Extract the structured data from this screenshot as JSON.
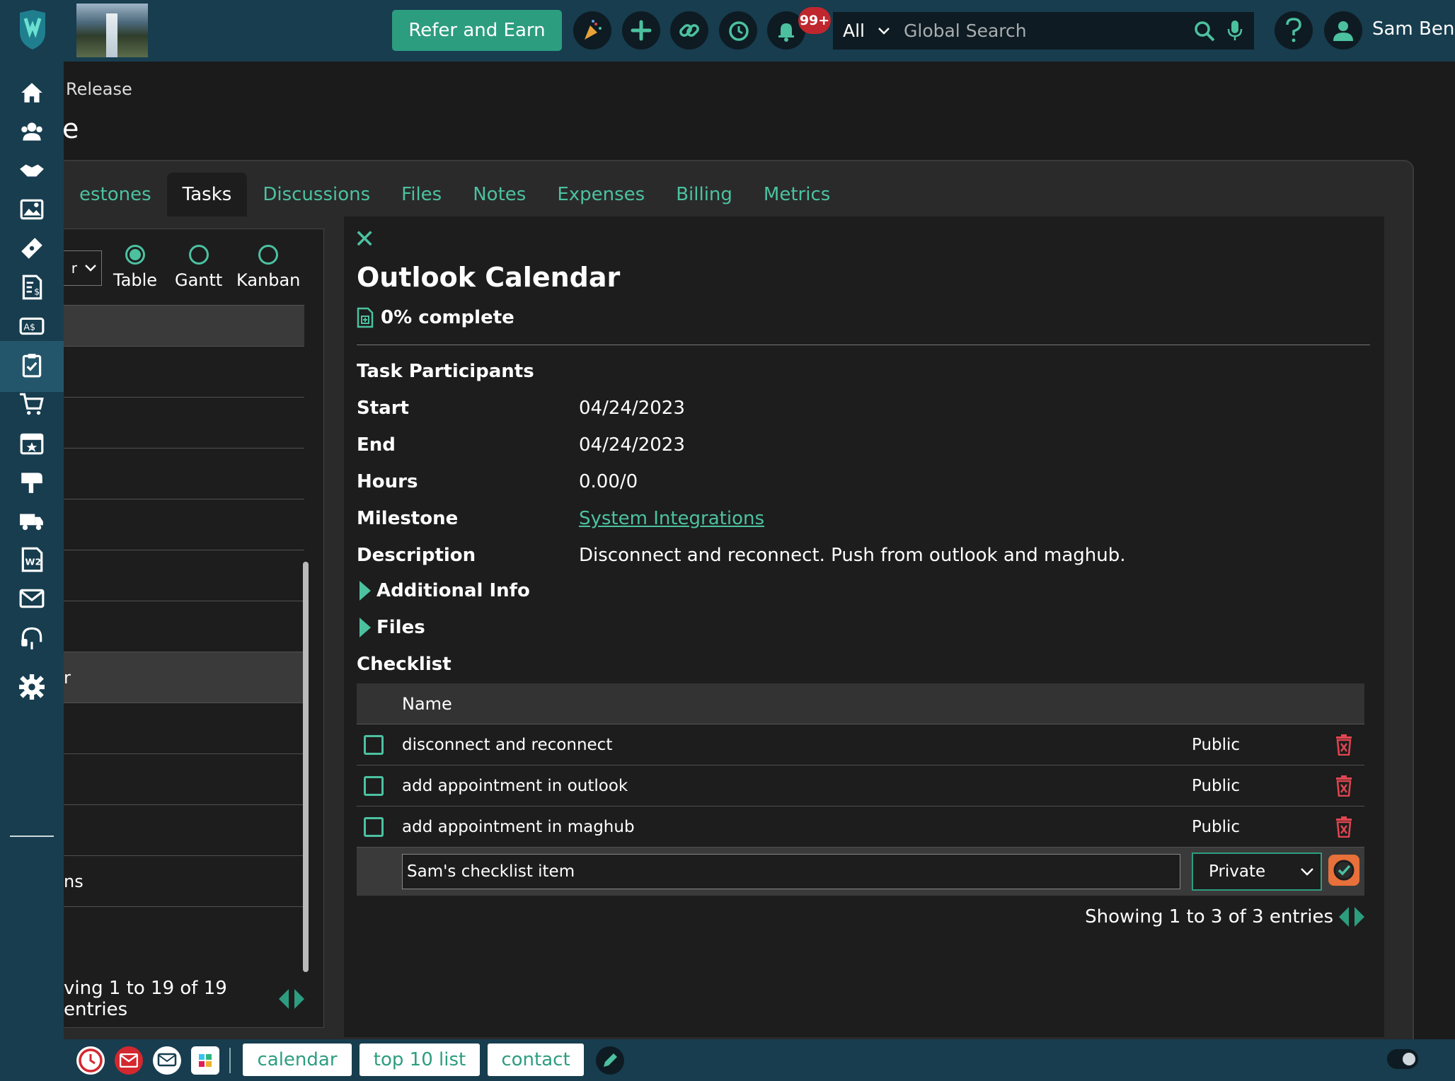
{
  "header": {
    "refer_label": "Refer and Earn",
    "notifications_badge": "99+",
    "search_scope": "All",
    "search_placeholder": "Global Search",
    "user_name": "Sam Bend",
    "icons": [
      "party-icon",
      "plus-icon",
      "link-icon",
      "history-icon",
      "bell-icon",
      "search-icon",
      "microphone-icon",
      "help-icon",
      "user-avatar-icon"
    ]
  },
  "sidebar": {
    "items": [
      {
        "name": "home-icon"
      },
      {
        "name": "contacts-icon"
      },
      {
        "name": "handshake-icon"
      },
      {
        "name": "gallery-icon"
      },
      {
        "name": "ticket-icon"
      },
      {
        "name": "invoice-icon"
      },
      {
        "name": "money-exchange-icon"
      },
      {
        "name": "tasks-clipboard-icon",
        "active": true
      },
      {
        "name": "cart-icon"
      },
      {
        "name": "calendar-star-icon"
      },
      {
        "name": "mailbox-icon"
      },
      {
        "name": "truck-icon"
      },
      {
        "name": "w2-form-icon"
      },
      {
        "name": "envelope-icon"
      },
      {
        "name": "support-icon"
      },
      {
        "name": "settings-gear-icon"
      }
    ]
  },
  "breadcrumb": "Release",
  "page_title_fragment": "e",
  "tabs": [
    {
      "label": "estones"
    },
    {
      "label": "Tasks",
      "active": true
    },
    {
      "label": "Discussions"
    },
    {
      "label": "Files"
    },
    {
      "label": "Notes"
    },
    {
      "label": "Expenses"
    },
    {
      "label": "Billing"
    },
    {
      "label": "Metrics"
    }
  ],
  "left_panel": {
    "filter_value": "r",
    "views": [
      {
        "label": "Table",
        "selected": true
      },
      {
        "label": "Gantt",
        "selected": false
      },
      {
        "label": "Kanban",
        "selected": false
      }
    ],
    "rows": [
      "",
      "",
      "",
      "",
      "",
      "",
      "",
      "r",
      "",
      "",
      "",
      "ns",
      ""
    ],
    "footer": "ving 1 to 19 of 19 entries"
  },
  "task": {
    "title": "Outlook Calendar",
    "progress": "0% complete",
    "participants_label": "Task Participants",
    "fields": [
      {
        "label": "Start",
        "value": "04/24/2023"
      },
      {
        "label": "End",
        "value": "04/24/2023"
      },
      {
        "label": "Hours",
        "value": "0.00/0"
      },
      {
        "label": "Milestone",
        "value": "System Integrations"
      },
      {
        "label": "Description",
        "value": "Disconnect and reconnect. Push from outlook and maghub."
      }
    ],
    "additional_info_label": "Additional Info",
    "files_label": "Files",
    "checklist_label": "Checklist",
    "checklist": {
      "name_header": "Name",
      "items": [
        {
          "name": "disconnect and reconnect",
          "visibility": "Public",
          "checked": false
        },
        {
          "name": "add appointment in outlook",
          "visibility": "Public",
          "checked": false
        },
        {
          "name": "add appointment in maghub",
          "visibility": "Public",
          "checked": false
        }
      ],
      "new_item_value": "Sam's checklist item",
      "new_item_visibility": "Private",
      "footer": "Showing 1 to 3 of 3 entries"
    }
  },
  "bottombar": {
    "chips": [
      "calendar",
      "top 10 list",
      "contact"
    ],
    "icons": [
      "clock-icon",
      "mail-icon",
      "message-icon",
      "slack-icon",
      "pencil-icon"
    ]
  },
  "colors": {
    "nav_bg": "#173d4f",
    "accent": "#2d9d80",
    "accent_text": "#4cc1a0",
    "danger": "#e04650",
    "confirm": "#e8703a"
  }
}
